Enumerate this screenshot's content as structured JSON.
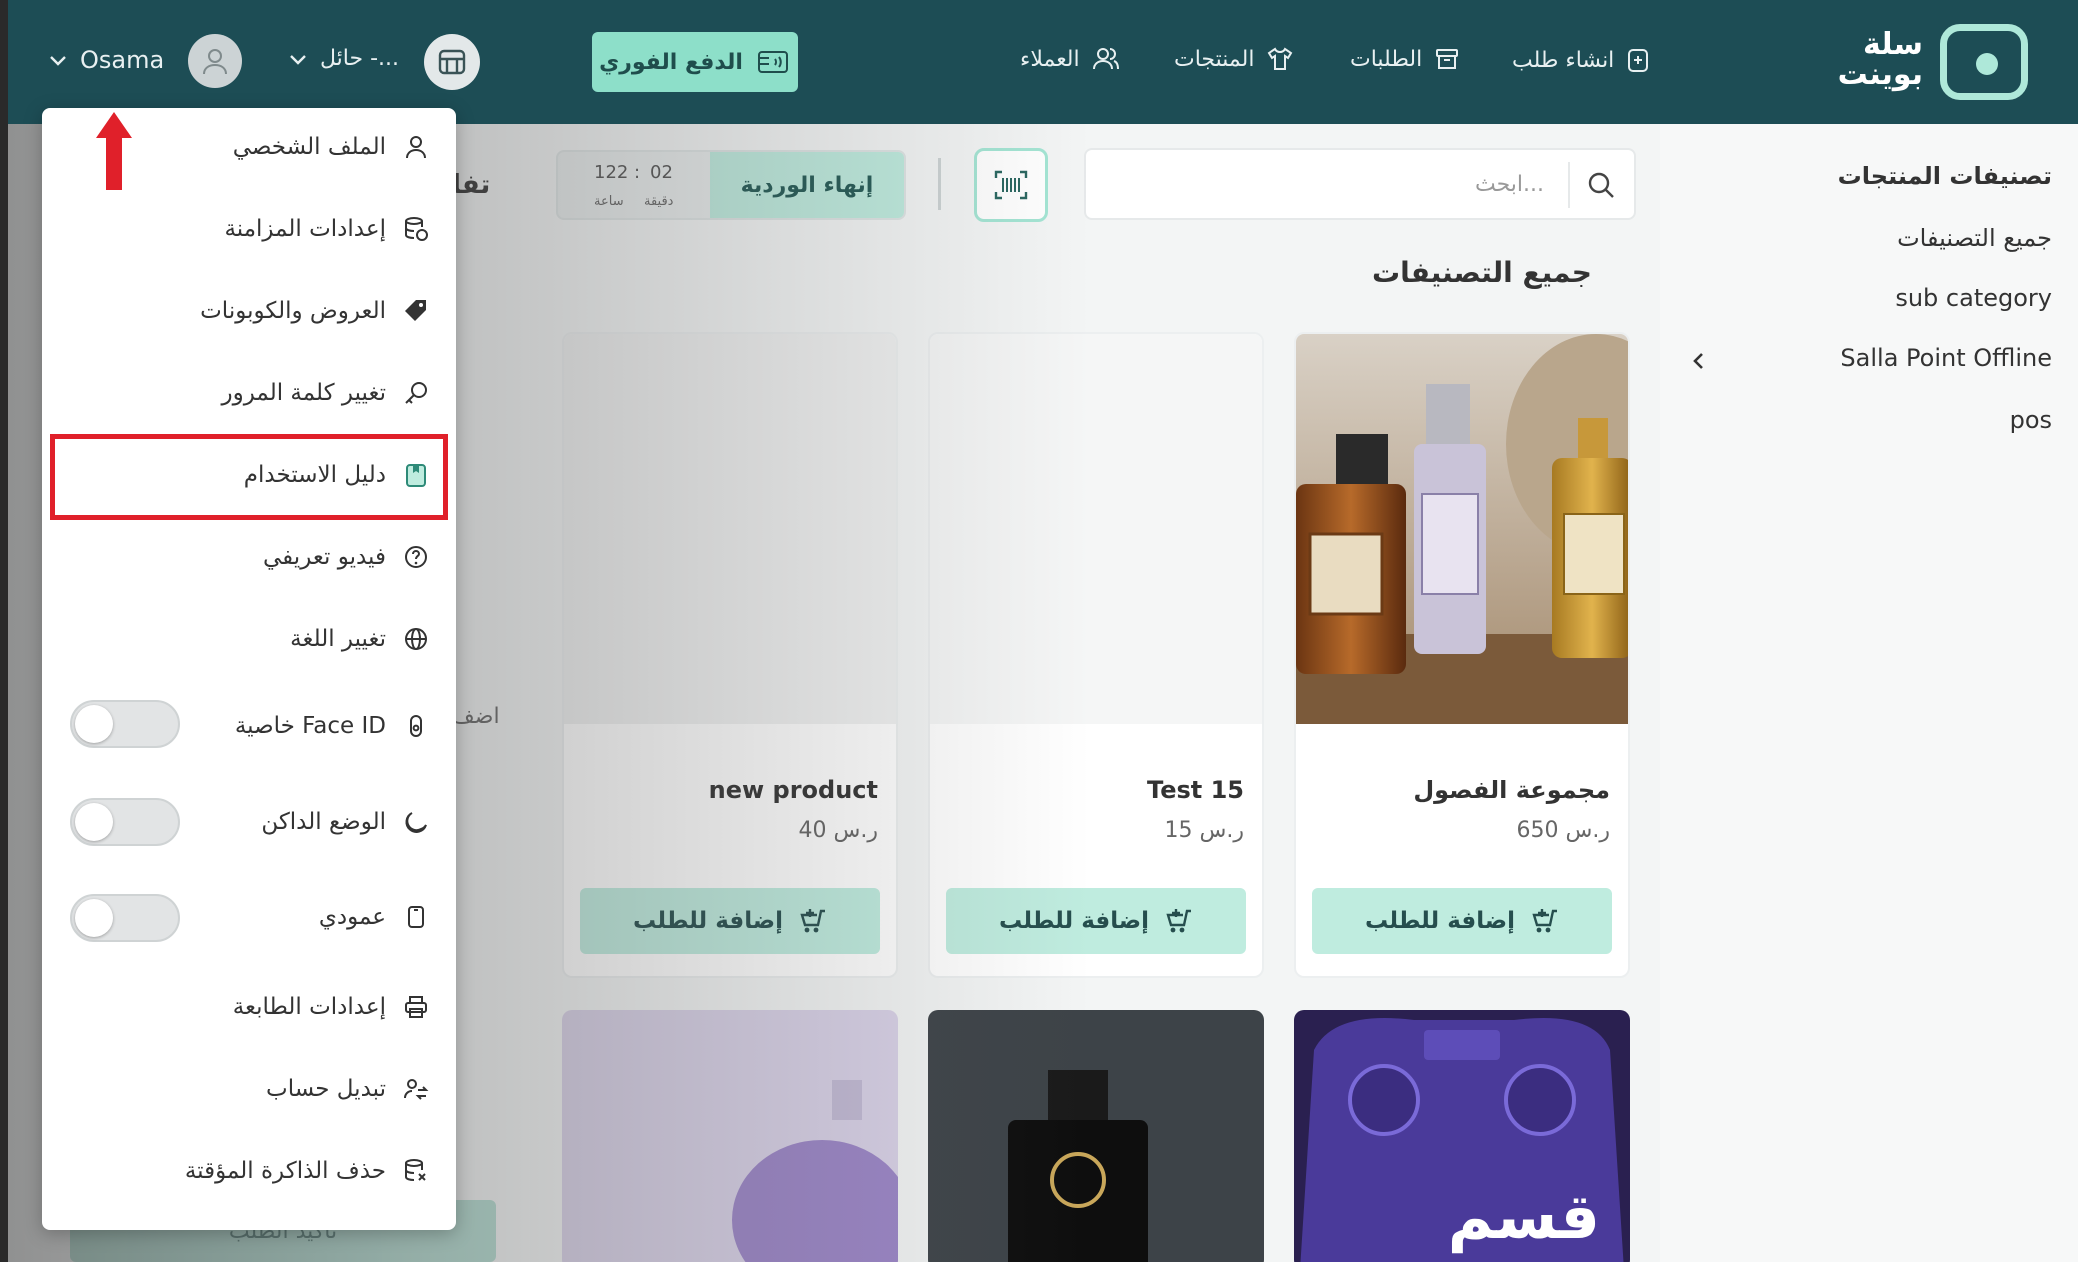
{
  "header": {
    "logo_line1": "سلة",
    "logo_line2": "بوينت",
    "nav": [
      {
        "label": "انشاء طلب",
        "icon": "new-order-icon"
      },
      {
        "label": "الطلبات",
        "icon": "orders-box-icon"
      },
      {
        "label": "المنتجات",
        "icon": "shirt-icon"
      },
      {
        "label": "العملاء",
        "icon": "users-icon"
      }
    ],
    "pay_button": "الدفع الفوري",
    "branch": "حائل -...",
    "user": "Osama"
  },
  "sidebar": {
    "title": "تصنيفات المنتجات",
    "items": [
      "جميع التصنيفات",
      "sub category",
      "Salla Point Offline",
      "pos"
    ]
  },
  "toolbar": {
    "search_placeholder": "ابحث...",
    "end_shift": "إنهاء الوردية",
    "timer_minutes": "02",
    "timer_hours": "122",
    "timer_sep": ":",
    "minutes_label": "دقيقة",
    "hours_label": "ساعة"
  },
  "main": {
    "section_title": "جميع التصنيفات",
    "add_label": "إضافة للطلب",
    "products": [
      {
        "name": "مجموعة الفصول",
        "price": "650 ر.س"
      },
      {
        "name": "Test 15",
        "price": "15 ر.س"
      },
      {
        "name": "new product",
        "price": "40 ر.س"
      }
    ],
    "bottom_card_text": "قسم",
    "behind_left_label": "تفا",
    "behind_side_label": "اضف",
    "behind_bottom_button": "تأكيد الطلب"
  },
  "menu": {
    "items": [
      {
        "label": "الملف الشخصي",
        "icon": "user-icon"
      },
      {
        "label": "إعدادات المزامنة",
        "icon": "database-sync-icon"
      },
      {
        "label": "العروض والكوبونات",
        "icon": "tag-icon"
      },
      {
        "label": "تغيير كلمة المرور",
        "icon": "key-icon"
      },
      {
        "label": "دليل الاستخدام",
        "icon": "guide-book-icon"
      },
      {
        "label": "فيديو تعريفي",
        "icon": "help-circle-icon"
      },
      {
        "label": "تغيير اللغة",
        "icon": "globe-icon"
      },
      {
        "label": "خاصية Face ID",
        "icon": "face-id-icon"
      },
      {
        "label": "الوضع الداكن",
        "icon": "moon-icon"
      },
      {
        "label": "عمودي",
        "icon": "portrait-icon"
      },
      {
        "label": "إعدادات الطابعة",
        "icon": "printer-icon"
      },
      {
        "label": "تبديل حساب",
        "icon": "switch-account-icon"
      },
      {
        "label": "حذف الذاكرة المؤقتة",
        "icon": "clear-cache-icon"
      }
    ],
    "highlight_color": "#e0202a"
  },
  "colors": {
    "header_bg": "#1d4d55",
    "accent": "#8ddfc9",
    "accent_light": "#bfecdf",
    "annotation_red": "#e0202a"
  }
}
